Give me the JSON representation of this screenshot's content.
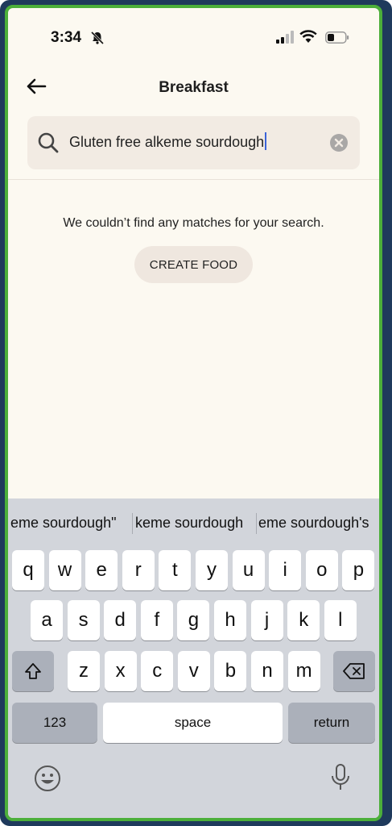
{
  "status_bar": {
    "time": "3:34"
  },
  "header": {
    "title": "Breakfast"
  },
  "search": {
    "value": "Gluten free alkeme sourdough"
  },
  "results": {
    "empty_message": "We couldn’t find any matches for your search.",
    "create_button": "CREATE FOOD"
  },
  "keyboard": {
    "suggestions": [
      "eme sourdough\"",
      "keme sourdough",
      "eme sourdough's"
    ],
    "row1": [
      "q",
      "w",
      "e",
      "r",
      "t",
      "y",
      "u",
      "i",
      "o",
      "p"
    ],
    "row2": [
      "a",
      "s",
      "d",
      "f",
      "g",
      "h",
      "j",
      "k",
      "l"
    ],
    "row3": [
      "z",
      "x",
      "c",
      "v",
      "b",
      "n",
      "m"
    ],
    "numbers_key": "123",
    "space_key": "space",
    "return_key": "return"
  },
  "icons": {
    "back": "arrow-left-icon",
    "search": "search-icon",
    "clear": "clear-icon",
    "shift": "shift-icon",
    "delete": "delete-icon",
    "emoji": "emoji-icon",
    "mic": "microphone-icon"
  },
  "colors": {
    "background": "#fcf9f1",
    "search_bg": "#f2ebe3",
    "keyboard_bg": "#d2d5db",
    "caret": "#3b63d8"
  }
}
